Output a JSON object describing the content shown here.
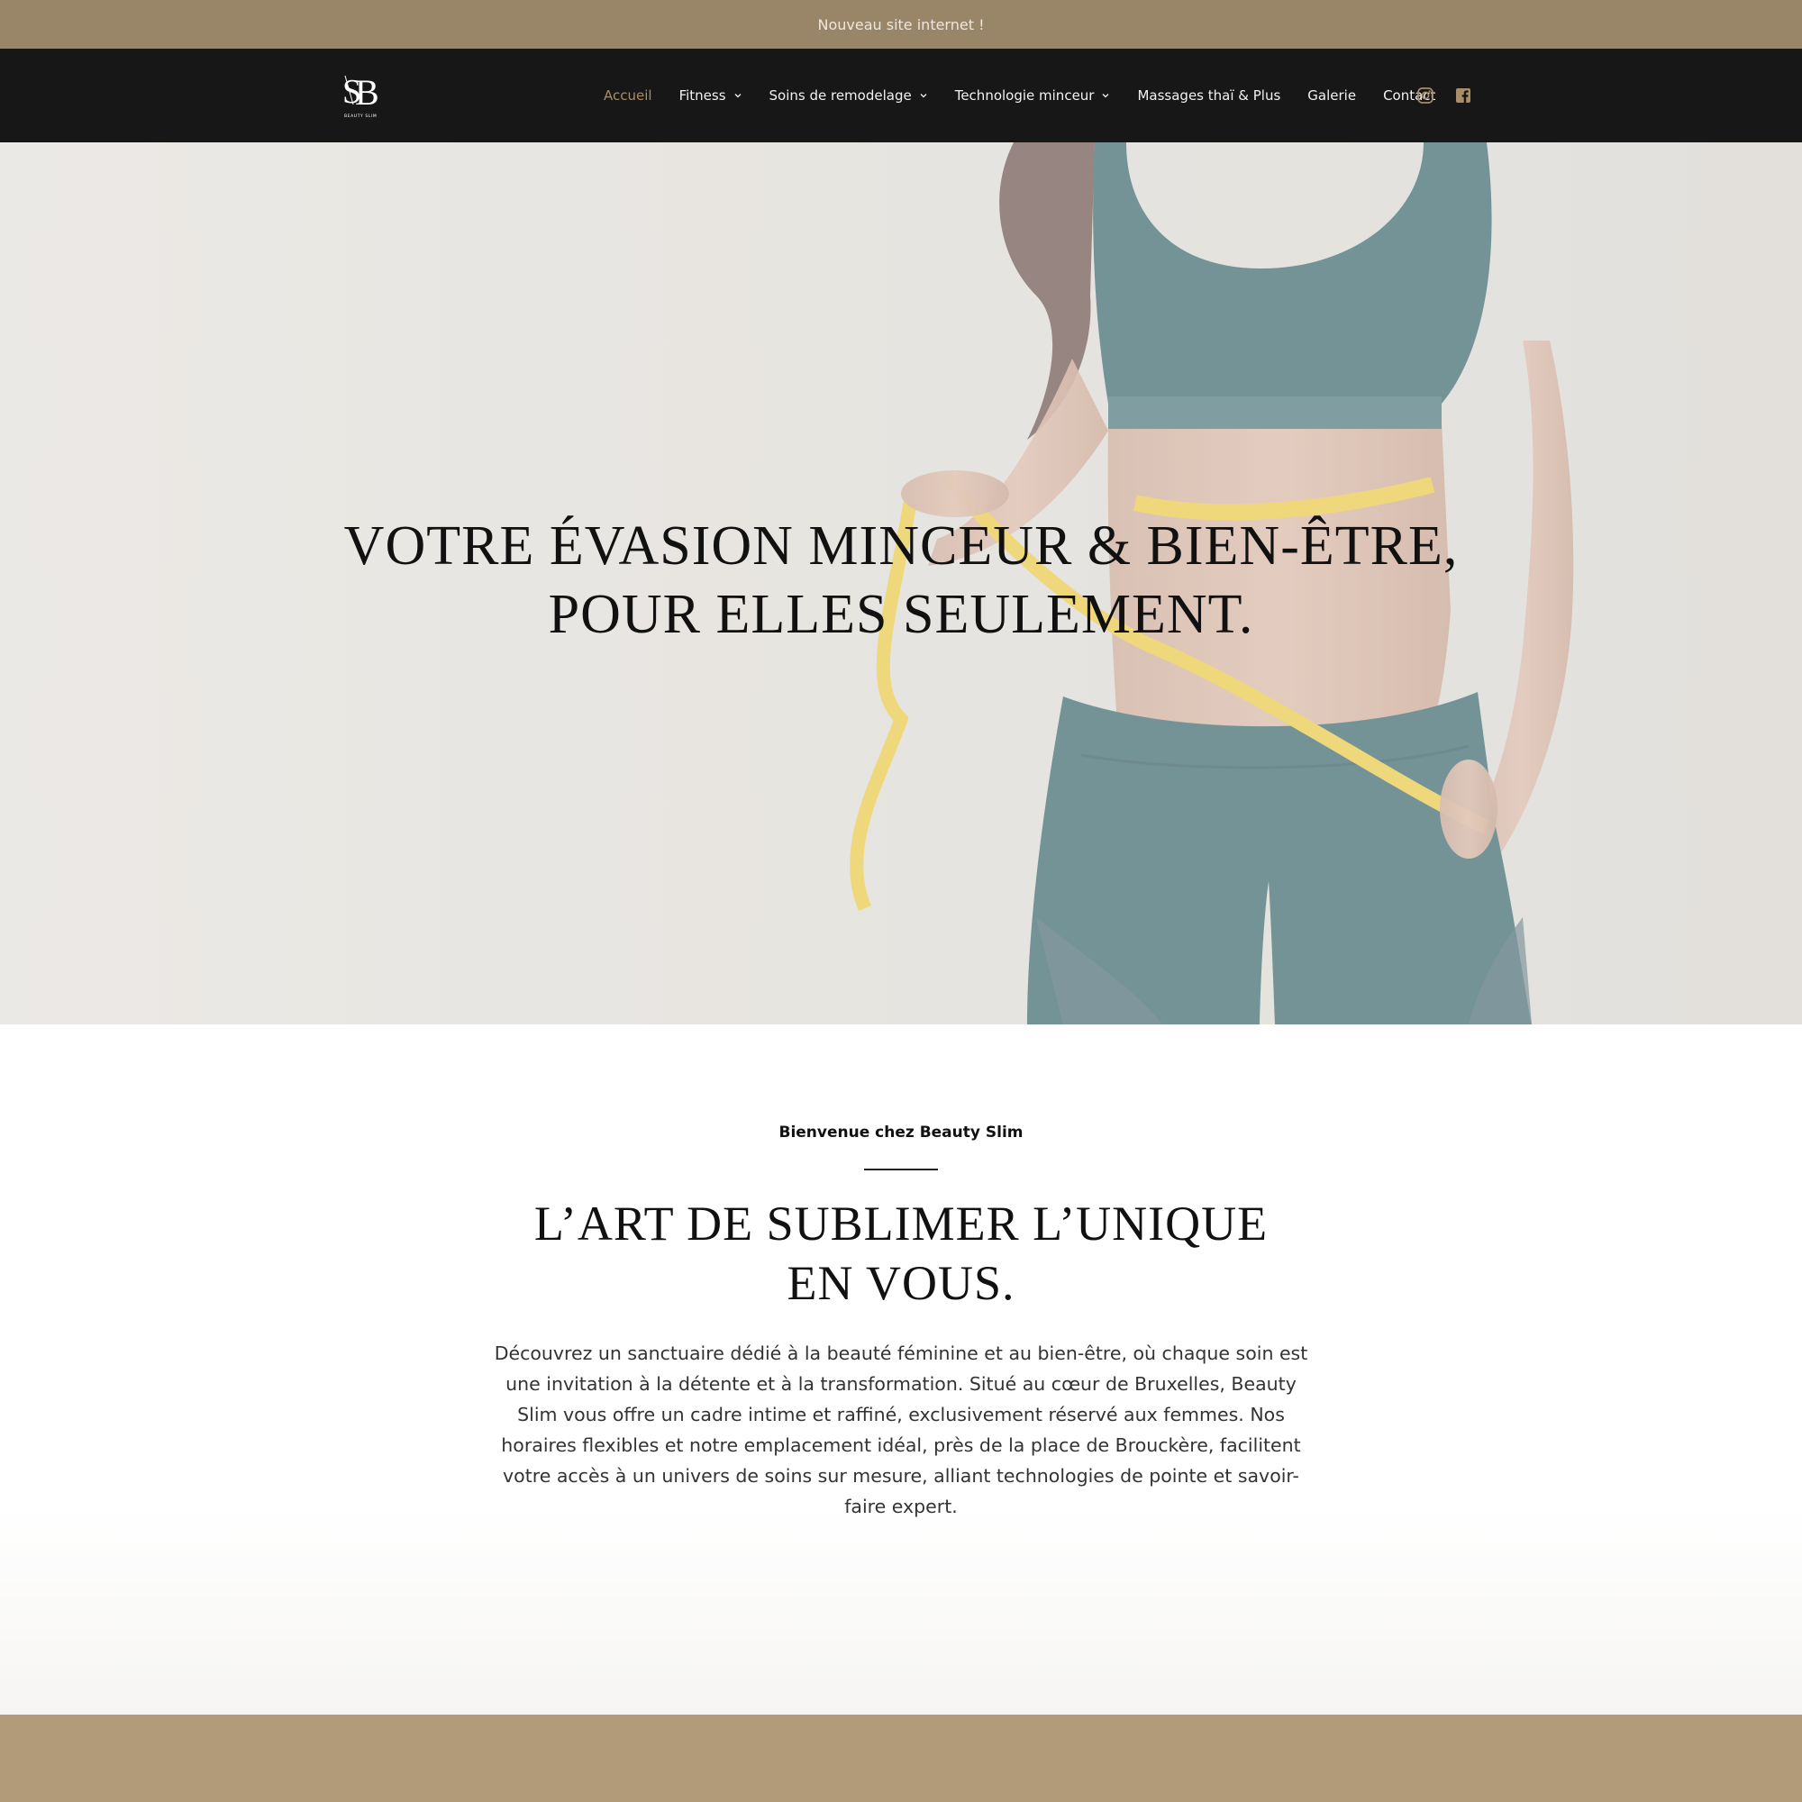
{
  "announcement": {
    "text": "Nouveau site internet !"
  },
  "brand": {
    "logo_text": "SB",
    "logo_subtext": "BEAUTY SLIM"
  },
  "nav": {
    "items": [
      {
        "label": "Accueil",
        "active": true,
        "dropdown": false
      },
      {
        "label": "Fitness",
        "active": false,
        "dropdown": true
      },
      {
        "label": "Soins de remodelage",
        "active": false,
        "dropdown": true
      },
      {
        "label": "Technologie minceur",
        "active": false,
        "dropdown": true
      },
      {
        "label": "Massages thaï & Plus",
        "active": false,
        "dropdown": false
      },
      {
        "label": "Galerie",
        "active": false,
        "dropdown": false
      },
      {
        "label": "Contact",
        "active": false,
        "dropdown": false
      }
    ]
  },
  "socials": [
    {
      "icon": "instagram-icon"
    },
    {
      "icon": "facebook-icon"
    }
  ],
  "hero": {
    "title": "Votre évasion minceur & bien-être, pour elles seulement."
  },
  "welcome": {
    "kicker": "Bienvenue chez Beauty Slim",
    "title": "L’art de sublimer l’unique en vous.",
    "text": "Découvrez un sanctuaire dédié à la beauté féminine et au bien-être, où chaque soin est une invitation à la détente et à la transformation. Situé au cœur de Bruxelles, Beauty Slim vous offre un cadre intime et raffiné, exclusivement réservé aux femmes. Nos horaires flexibles et notre emplacement idéal, près de la place de Brouckère, facilitent votre accès à un univers de soins sur mesure, alliant technologies de pointe et savoir-faire expert."
  },
  "colors": {
    "announcement_bg": "#998568",
    "header_bg": "#171717",
    "accent": "#a88d66",
    "bottom_band": "#b29b79"
  }
}
